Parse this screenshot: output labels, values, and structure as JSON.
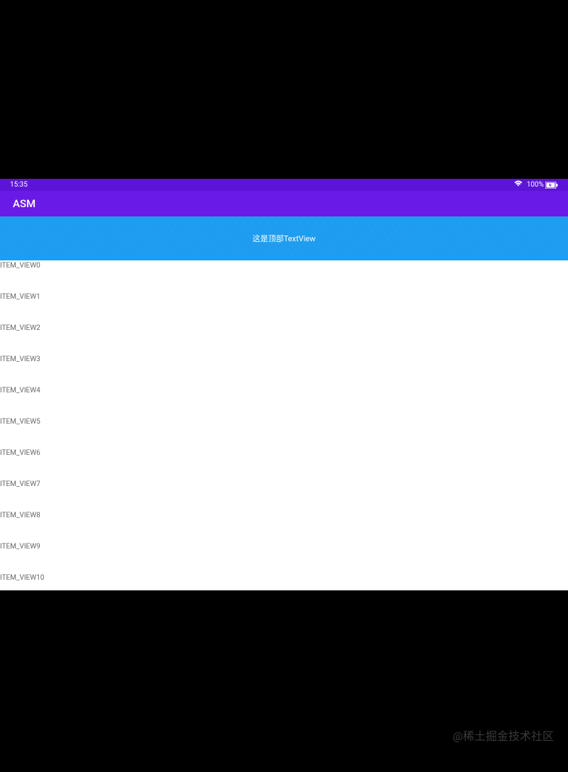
{
  "statusBar": {
    "time": "15:35",
    "batteryPercent": "100%"
  },
  "appBar": {
    "title": "ASM"
  },
  "topTextView": {
    "text": "这是顶部TextView"
  },
  "listItems": [
    {
      "label": "ITEM_VIEW0"
    },
    {
      "label": "ITEM_VIEW1"
    },
    {
      "label": "ITEM_VIEW2"
    },
    {
      "label": "ITEM_VIEW3"
    },
    {
      "label": "ITEM_VIEW4"
    },
    {
      "label": "ITEM_VIEW5"
    },
    {
      "label": "ITEM_VIEW6"
    },
    {
      "label": "ITEM_VIEW7"
    },
    {
      "label": "ITEM_VIEW8"
    },
    {
      "label": "ITEM_VIEW9"
    },
    {
      "label": "ITEM_VIEW10"
    }
  ],
  "watermark": {
    "text": "@稀土掘金技术社区"
  }
}
